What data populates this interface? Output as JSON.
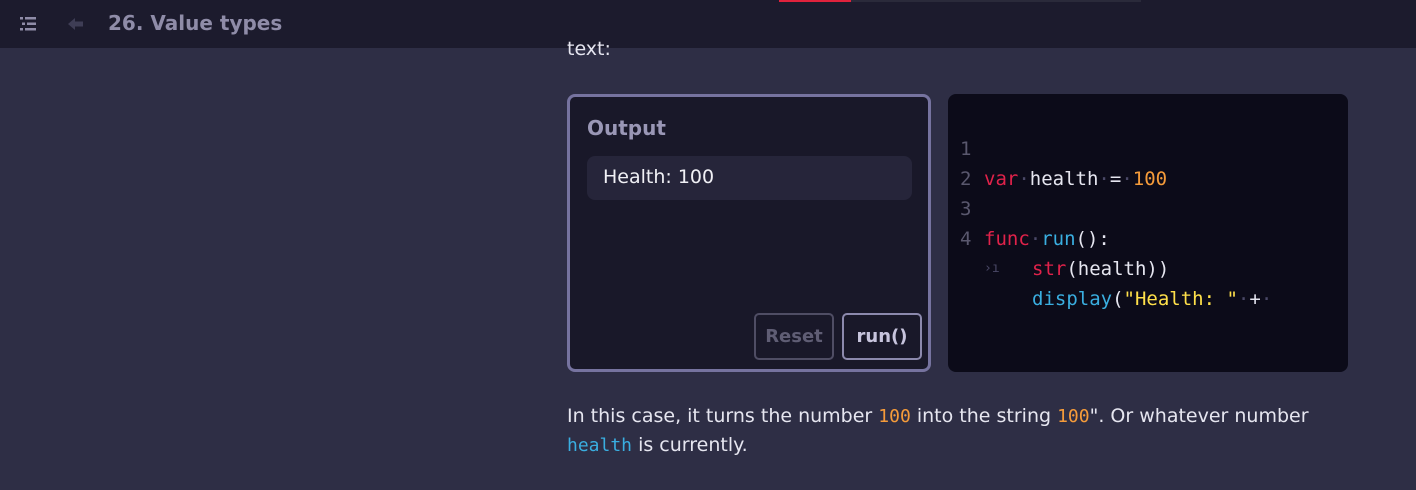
{
  "header": {
    "title": "26. Value types",
    "progress_fraction": 0.2
  },
  "lesson": {
    "cutoff_text": "text:",
    "paragraph": {
      "part1": "In this case, it turns the number ",
      "code1": "100",
      "part2": " into the string ",
      "code2": "100",
      "part3": "\". Or whatever number ",
      "code3": "health",
      "part4": " is currently."
    }
  },
  "output_panel": {
    "title": "Output",
    "output_text": "Health: 100",
    "reset_label": "Reset",
    "run_label": "run()"
  },
  "code_panel": {
    "line_numbers": [
      "1",
      "2",
      "3",
      "4"
    ],
    "line1": {
      "kw": "var",
      "name": "health",
      "op": "=",
      "value": "100"
    },
    "line3": {
      "kw": "func",
      "fn": "run",
      "rest": "():"
    },
    "line4": {
      "fn": "display",
      "open": "(",
      "str": "\"Health: \"",
      "op": "+"
    },
    "line4b": {
      "fn": "str",
      "rest": "(health))"
    }
  },
  "colors": {
    "keyword": "#e0224a",
    "number": "#f59b3a",
    "function": "#3aaee0",
    "string": "#ffe04a",
    "progress": "#e0223c"
  },
  "icons": {
    "menu": "list-menu-icon",
    "back": "arrow-left-icon"
  }
}
